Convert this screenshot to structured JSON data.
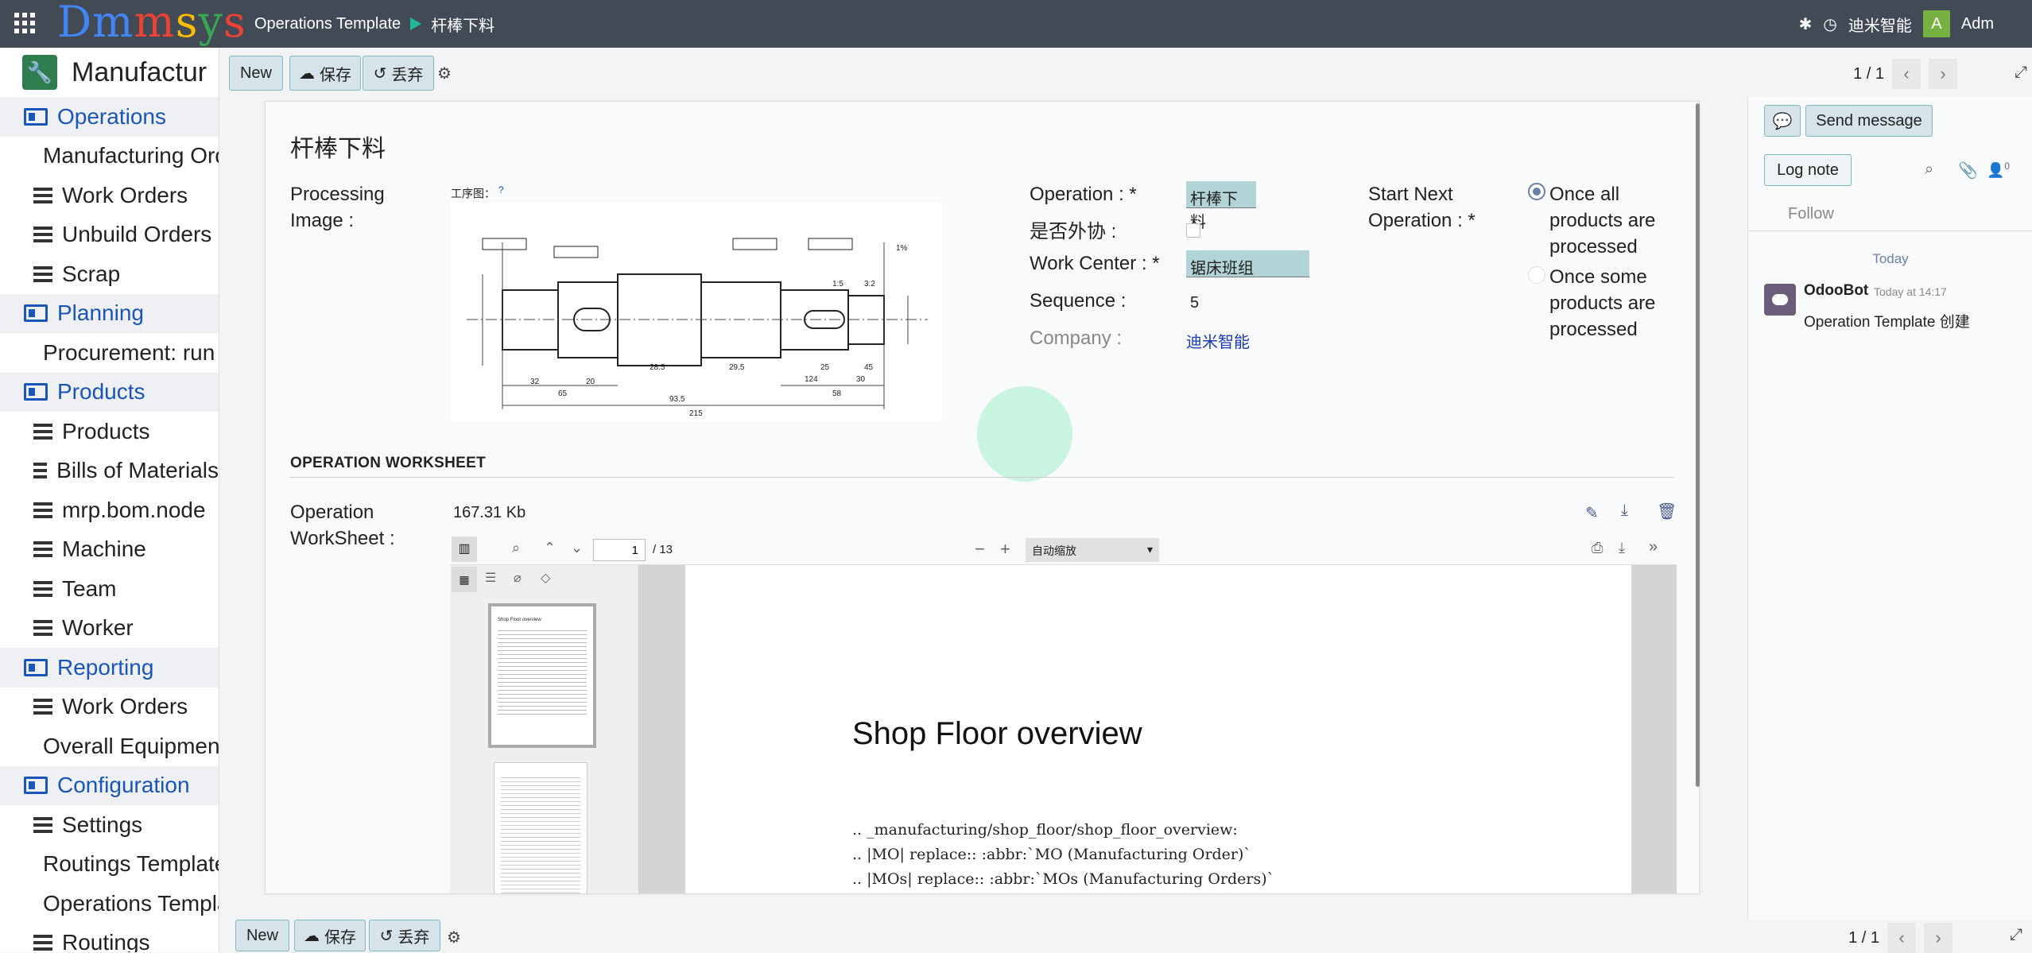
{
  "topbar": {
    "logo": "Dmmsys",
    "breadcrumb_parent": "Operations Template",
    "breadcrumb_current": "杆棒下料",
    "company": "迪米智能",
    "avatar_letter": "A",
    "user": "Adm"
  },
  "sidebar": {
    "app_title": "Manufactur",
    "sections": [
      {
        "label": "Operations",
        "items": [
          "Manufacturing Orders",
          "Work Orders",
          "Unbuild Orders",
          "Scrap"
        ]
      },
      {
        "label": "Planning",
        "items": [
          "Procurement: run scheduler"
        ]
      },
      {
        "label": "Products",
        "items": [
          "Products",
          "Bills of Materials",
          "mrp.bom.node",
          "Machine",
          "Team",
          "Worker"
        ]
      },
      {
        "label": "Reporting",
        "items": [
          "Work Orders",
          "Overall Equipment Effectiveness"
        ]
      },
      {
        "label": "Configuration",
        "items": [
          "Settings",
          "Routings Templates",
          "Operations Templates",
          "Routings"
        ]
      }
    ]
  },
  "control": {
    "new": "New",
    "save": "保存",
    "discard": "丢弃",
    "pager": "1 / 1"
  },
  "form": {
    "title": "杆棒下料",
    "processing_image_label": "Processing Image :",
    "image_caption": "工序图：",
    "image_help": "?",
    "operation_label": "Operation :",
    "operation_value": "杆棒下料",
    "outsource_label": "是否外协 :",
    "work_center_label": "Work Center :",
    "work_center_value": "锯床班组",
    "sequence_label": "Sequence :",
    "sequence_value": "5",
    "company_label": "Company :",
    "company_value": "迪米智能",
    "start_next_label": "Start Next Operation :",
    "radio_options": [
      "Once all products are processed",
      "Once some products are processed"
    ],
    "radio_selected": 0,
    "worksheet_section": "OPERATION WORKSHEET",
    "worksheet_label": "Operation WorkSheet :",
    "worksheet_size": "167.31 Kb"
  },
  "pdf": {
    "page_input": "1",
    "page_total": "/ 13",
    "zoom": "自动缩放",
    "heading": "Shop Floor overview",
    "lines": [
      ".. _manufacturing/shop_floor/shop_floor_overview:",
      ".. |MO| replace:: :abbr:`MO (Manufacturing Order)`",
      ".. |MOs| replace:: :abbr:`MOs (Manufacturing Orders)`"
    ],
    "thumb1_title": "Shop Floor overview"
  },
  "chatter": {
    "send_message": "Send message",
    "log_note": "Log note",
    "follower_count": "0",
    "follow": "Follow",
    "date_sep": "Today",
    "author": "OdooBot",
    "time": "Today at 14:17",
    "body": "Operation Template 创建"
  },
  "drawing_text": [
    "93.5",
    "124",
    "215",
    "32",
    "20",
    "65",
    "58",
    "25",
    "29.5",
    "28.5",
    "45",
    "30",
    "3:2",
    "1:5",
    "1%"
  ]
}
